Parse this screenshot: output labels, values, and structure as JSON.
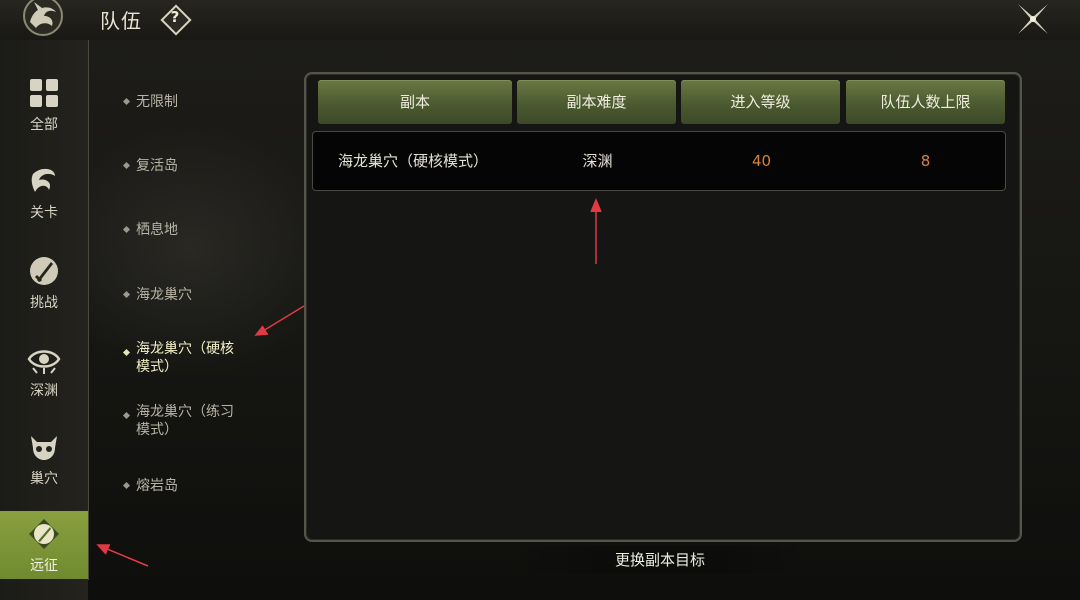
{
  "header": {
    "title": "队伍",
    "help_label": "?",
    "logo_icon": "dragon-emblem-icon",
    "close_icon": "close-x-icon"
  },
  "sidebar": {
    "items": [
      {
        "label": "全部",
        "icon": "grid-icon",
        "active": false
      },
      {
        "label": "关卡",
        "icon": "swirl-icon",
        "active": false
      },
      {
        "label": "挑战",
        "icon": "sword-icon",
        "active": false
      },
      {
        "label": "深渊",
        "icon": "eye-icon",
        "active": false
      },
      {
        "label": "巢穴",
        "icon": "skull-icon",
        "active": false
      },
      {
        "label": "远征",
        "icon": "quill-icon",
        "active": true
      }
    ]
  },
  "dungeon_list": {
    "items": [
      {
        "label": "无限制",
        "selected": false
      },
      {
        "label": "复活岛",
        "selected": false
      },
      {
        "label": "栖息地",
        "selected": false
      },
      {
        "label": "海龙巢穴",
        "selected": false
      },
      {
        "label": "海龙巢穴（硬核模式）",
        "selected": true
      },
      {
        "label": "海龙巢穴（练习模式）",
        "selected": false
      },
      {
        "label": "熔岩岛",
        "selected": false
      }
    ]
  },
  "table": {
    "headers": [
      "副本",
      "副本难度",
      "进入等级",
      "队伍人数上限"
    ],
    "rows": [
      {
        "name": "海龙巢穴（硬核模式）",
        "difficulty": "深渊",
        "level": "40",
        "max_members": "8"
      }
    ]
  },
  "footer": {
    "change_target_label": "更换副本目标"
  },
  "colors": {
    "accent_green": "#6f8a2f",
    "header_green": "#4b5a30",
    "number_orange": "#d9823c",
    "annotation_red": "#e03a45"
  }
}
